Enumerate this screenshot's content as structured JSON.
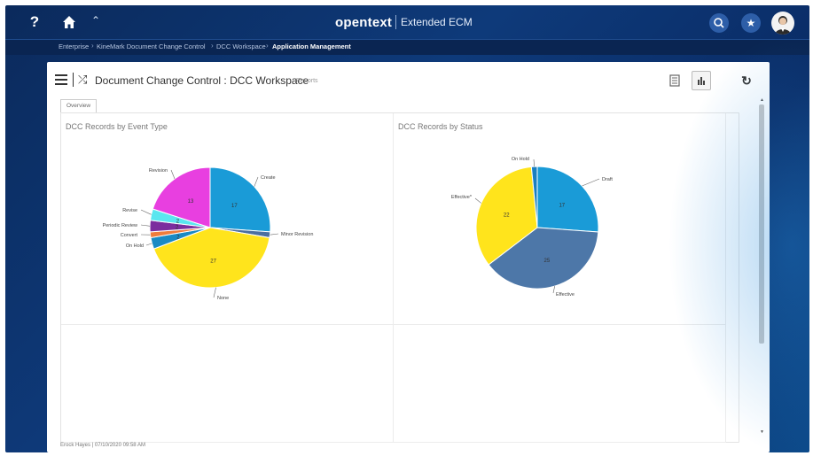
{
  "topbar": {
    "help_icon": "?",
    "brand": "opentext",
    "product": "Extended ECM"
  },
  "breadcrumb": [
    "Enterprise",
    "KineMark Document Change Control",
    "DCC Workspace",
    "Application Management"
  ],
  "panel": {
    "title": "Document Change Control : DCC Workspace",
    "subtitle": "Reports",
    "tab": "Overview",
    "footer": "Erock Hayes | 07/10/2020 09:58 AM"
  },
  "chart_data": [
    {
      "type": "pie",
      "title": "DCC Records by Event Type",
      "slices": [
        {
          "label": "Create",
          "value": 17,
          "color": "#1a9bd7"
        },
        {
          "label": "Minor Revision",
          "value": 1,
          "color": "#4b6fa0"
        },
        {
          "label": "None",
          "value": 27,
          "color": "#ffe41c"
        },
        {
          "label": "On Hold",
          "value": 2,
          "color": "#1a8ac4"
        },
        {
          "label": "Convert",
          "value": 1,
          "color": "#f07c3c"
        },
        {
          "label": "Periodic Review",
          "value": 2,
          "color": "#7b2e9e"
        },
        {
          "label": "Revise",
          "value": 2,
          "color": "#5ae6ef"
        },
        {
          "label": "Revision",
          "value": 13,
          "color": "#e83fe0"
        }
      ]
    },
    {
      "type": "pie",
      "title": "DCC Records by Status",
      "slices": [
        {
          "label": "Draft",
          "value": 17,
          "color": "#1a9bd7"
        },
        {
          "label": "Effective",
          "value": 25,
          "color": "#4d77a8"
        },
        {
          "label": "Effective*",
          "value": 22,
          "color": "#ffe41c"
        },
        {
          "label": "On Hold",
          "value": 1,
          "color": "#1a7fc0"
        }
      ]
    }
  ],
  "toolbar": {
    "list_icon": "list-view-icon",
    "chart_icon": "chart-view-icon",
    "refresh_icon": "refresh-icon"
  }
}
